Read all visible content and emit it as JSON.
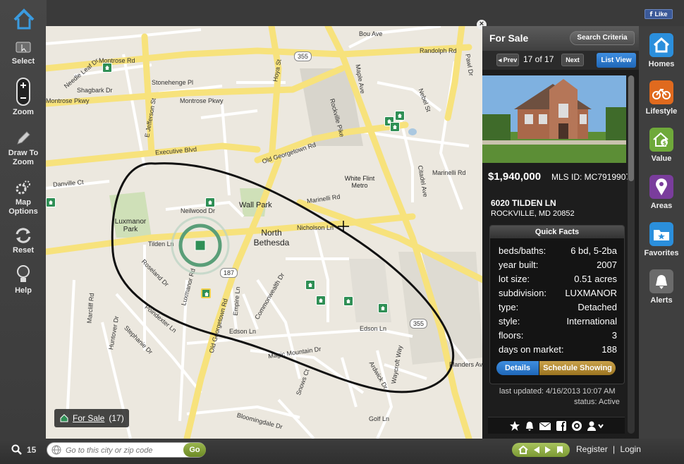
{
  "left_toolbar": {
    "items": [
      {
        "label": "Select"
      },
      {
        "label": "Zoom"
      },
      {
        "label": "Draw To Zoom"
      },
      {
        "label": "Map Options"
      },
      {
        "label": "Reset"
      },
      {
        "label": "Help"
      }
    ]
  },
  "map": {
    "road_labels": [
      "Montrose Rd",
      "Montrose Pkwy",
      "Montrose Pkwy",
      "Randolph Rd",
      "Needle Leaf Dr",
      "Shagbark Dr",
      "Stonehenge Pl",
      "E Jefferson St",
      "Hoya St",
      "Rockville Pike",
      "Maple Ave",
      "Nebel St",
      "Executive Blvd",
      "Old Georgetown Rd",
      "Marinelli Rd",
      "Marinelli Rd",
      "Citadel Ave",
      "Danville Ct",
      "Neilwood Dr",
      "Nicholson Ln",
      "Tilden Ln",
      "Roseland Dr",
      "Luxmanor Rd",
      "Old Georgetown Rd",
      "Empire Ln",
      "Commonwealth Dr",
      "Edson Ln",
      "Edson Ln",
      "Magic Mountain Dr",
      "Marcliff Rd",
      "Huntover Dr",
      "Stephanie Dr",
      "Poindexter Ln",
      "Bloomingdale Dr",
      "Flanders Ave",
      "Ardwick Dr",
      "Waycroft Way",
      "Golf Ln",
      "Bou Ave",
      "Pawl Dr",
      "Snows Ct"
    ],
    "place_labels": [
      "Wall Park",
      "North Bethesda",
      "Luxmanor Park",
      "White Flint Metro"
    ],
    "shields": [
      "355",
      "187",
      "355"
    ]
  },
  "map_chip": {
    "label": "For Sale",
    "count": "(17)"
  },
  "panel": {
    "title": "For Sale",
    "search_criteria": "Search Criteria",
    "prev": "Prev",
    "next": "Next",
    "counter": "17 of 17",
    "list_view": "List View",
    "price": "$1,940,000",
    "mls": "MLS ID: MC7919907",
    "address_line1": "6020 TILDEN LN",
    "address_line2": "ROCKVILLE, MD  20852",
    "facts_title": "Quick Facts",
    "facts": [
      {
        "k": "beds/baths:",
        "v": "6 bd, 5-2ba"
      },
      {
        "k": "year built:",
        "v": "2007"
      },
      {
        "k": "lot size:",
        "v": "0.51 acres"
      },
      {
        "k": "subdivision:",
        "v": "LUXMANOR"
      },
      {
        "k": "type:",
        "v": "Detached"
      },
      {
        "k": "style:",
        "v": "International"
      },
      {
        "k": "floors:",
        "v": "3"
      },
      {
        "k": "days on market:",
        "v": "188"
      }
    ],
    "details": "Details",
    "schedule": "Schedule Showing",
    "updated": "last updated: 4/16/2013 10:07 AM",
    "status": "status: Active"
  },
  "categories": [
    {
      "label": "Homes",
      "color": "#2b8fdc"
    },
    {
      "label": "Lifestyle",
      "color": "#e06a1e"
    },
    {
      "label": "Value",
      "color": "#6fa93a"
    },
    {
      "label": "Areas",
      "color": "#7a3d9c"
    },
    {
      "label": "Favorites",
      "color": "#2b8fdc"
    },
    {
      "label": "Alerts",
      "color": "#6b6b6b"
    }
  ],
  "top": {
    "fb_like": "Like"
  },
  "bottom": {
    "count": "15",
    "search_placeholder": "Go to this city or zip code",
    "go": "Go",
    "register": "Register",
    "login": "Login",
    "sep": "|"
  }
}
